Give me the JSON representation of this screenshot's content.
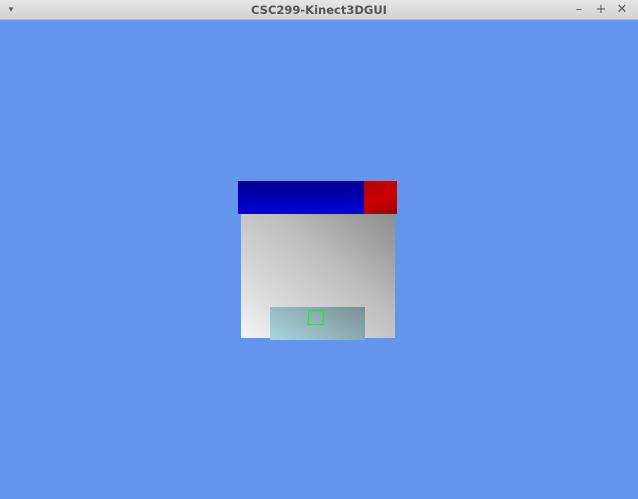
{
  "window": {
    "title": "CSC299-Kinect3DGUI",
    "menu_glyph": "▾",
    "minimize_glyph": "–",
    "maximize_glyph": "+",
    "close_glyph": "✕"
  },
  "colors": {
    "background": "#6495ed",
    "bar_primary": "#0000d0",
    "bar_secondary": "#c00000",
    "panel": "#bdbdbd",
    "sub_panel": "#98bec4",
    "cursor": "#00ff00"
  }
}
